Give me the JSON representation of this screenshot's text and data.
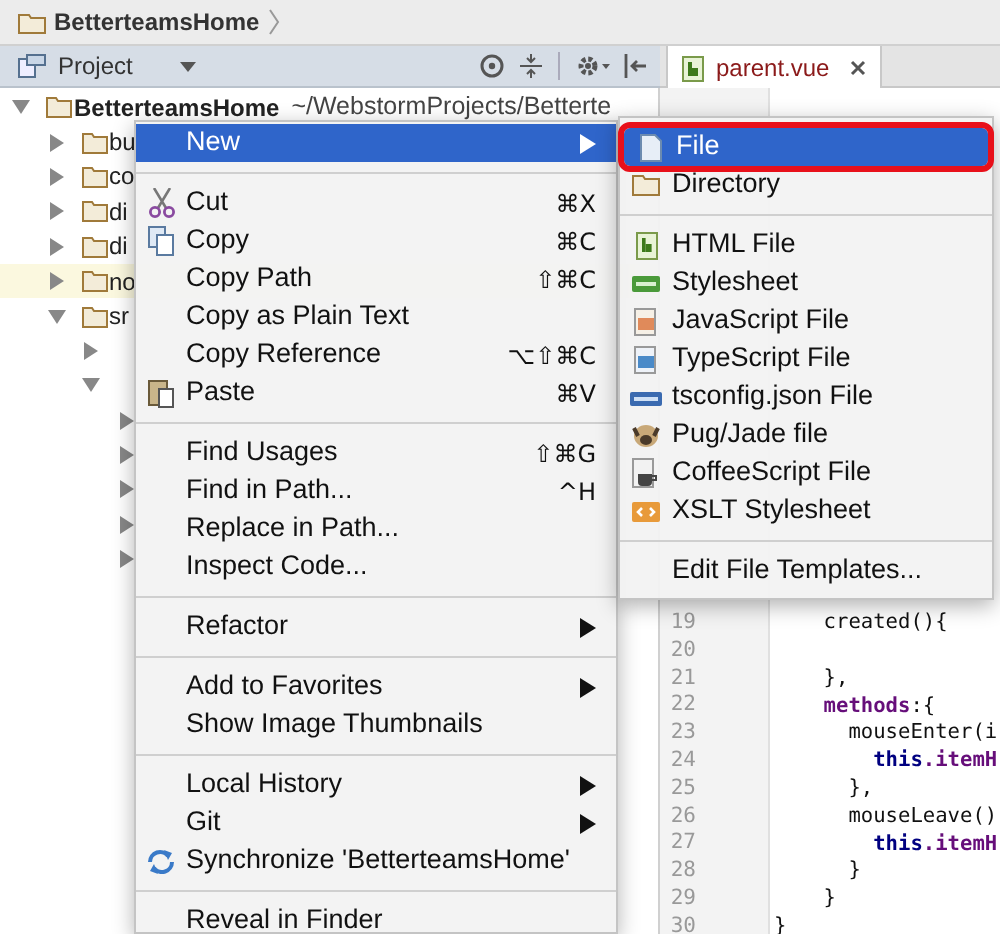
{
  "breadcrumb": {
    "label": "BetterteamsHome"
  },
  "project_panel": {
    "title": "Project"
  },
  "editor_tabs": [
    {
      "label": "parent.vue",
      "selected": true
    }
  ],
  "tree": [
    {
      "name": "BetterteamsHome",
      "path": "~/WebstormProjects/Betterte",
      "expanded": true,
      "highlighted": false,
      "children": [
        {
          "name": "bu",
          "expanded": false,
          "highlighted": false
        },
        {
          "name": "co",
          "expanded": false,
          "highlighted": false
        },
        {
          "name": "di",
          "expanded": false,
          "highlighted": false
        },
        {
          "name": "di",
          "expanded": false,
          "highlighted": false
        },
        {
          "name": "no",
          "expanded": false,
          "highlighted": true
        },
        {
          "name": "sr",
          "expanded": true,
          "highlighted": false,
          "children": [
            {
              "expanded": false,
              "highlighted": false
            },
            {
              "expanded": true,
              "highlighted": false,
              "children": [
                {
                  "expanded": false,
                  "highlighted": false
                },
                {
                  "expanded": false,
                  "highlighted": false
                },
                {
                  "expanded": false,
                  "highlighted": false
                },
                {
                  "expanded": false,
                  "highlighted": false
                },
                {
                  "expanded": false,
                  "highlighted": false
                }
              ]
            }
          ]
        }
      ]
    }
  ],
  "context_menu": [
    {
      "kind": "item",
      "label": "New",
      "submenu": true,
      "selected": true
    },
    {
      "kind": "separator"
    },
    {
      "kind": "item",
      "label": "Cut",
      "shortcut": "⌘X",
      "selected": false
    },
    {
      "kind": "item",
      "label": "Copy",
      "shortcut": "⌘C",
      "selected": false
    },
    {
      "kind": "item",
      "label": "Copy Path",
      "shortcut": "⇧⌘C",
      "selected": false
    },
    {
      "kind": "item",
      "label": "Copy as Plain Text",
      "selected": false
    },
    {
      "kind": "item",
      "label": "Copy Reference",
      "shortcut": "⌥⇧⌘C",
      "selected": false
    },
    {
      "kind": "item",
      "label": "Paste",
      "shortcut": "⌘V",
      "selected": false
    },
    {
      "kind": "separator"
    },
    {
      "kind": "item",
      "label": "Find Usages",
      "shortcut": "⇧⌘G",
      "selected": false
    },
    {
      "kind": "item",
      "label": "Find in Path...",
      "shortcut": "^H",
      "selected": false
    },
    {
      "kind": "item",
      "label": "Replace in Path...",
      "selected": false
    },
    {
      "kind": "item",
      "label": "Inspect Code...",
      "selected": false
    },
    {
      "kind": "separator"
    },
    {
      "kind": "item",
      "label": "Refactor",
      "submenu": true,
      "selected": false
    },
    {
      "kind": "separator"
    },
    {
      "kind": "item",
      "label": "Add to Favorites",
      "submenu": true,
      "selected": false
    },
    {
      "kind": "item",
      "label": "Show Image Thumbnails",
      "selected": false
    },
    {
      "kind": "separator"
    },
    {
      "kind": "item",
      "label": "Local History",
      "submenu": true,
      "selected": false
    },
    {
      "kind": "item",
      "label": "Git",
      "submenu": true,
      "selected": false
    },
    {
      "kind": "item",
      "label": "Synchronize 'BetterteamsHome'",
      "selected": false
    },
    {
      "kind": "separator"
    },
    {
      "kind": "item",
      "label": "Reveal in Finder",
      "selected": false
    }
  ],
  "new_submenu": [
    {
      "kind": "item",
      "label": "File",
      "selected": true,
      "outlined": true
    },
    {
      "kind": "item",
      "label": "Directory",
      "selected": false,
      "outlined": false
    },
    {
      "kind": "separator"
    },
    {
      "kind": "item",
      "label": "HTML File",
      "selected": false,
      "outlined": false
    },
    {
      "kind": "item",
      "label": "Stylesheet",
      "selected": false,
      "outlined": false
    },
    {
      "kind": "item",
      "label": "JavaScript File",
      "selected": false,
      "outlined": false
    },
    {
      "kind": "item",
      "label": "TypeScript File",
      "selected": false,
      "outlined": false
    },
    {
      "kind": "item",
      "label": "tsconfig.json File",
      "selected": false,
      "outlined": false
    },
    {
      "kind": "item",
      "label": "Pug/Jade file",
      "selected": false,
      "outlined": false
    },
    {
      "kind": "item",
      "label": "CoffeeScript File",
      "selected": false,
      "outlined": false
    },
    {
      "kind": "item",
      "label": "XSLT Stylesheet",
      "selected": false,
      "outlined": false
    },
    {
      "kind": "separator"
    },
    {
      "kind": "item",
      "label": "Edit File Templates...",
      "selected": false,
      "outlined": false
    }
  ],
  "code_lines": [
    {
      "number": "19",
      "tokens": [
        {
          "text": "    created(){",
          "kind": "plain"
        }
      ]
    },
    {
      "number": "20"
    },
    {
      "number": "21",
      "tokens": [
        {
          "text": "    },",
          "kind": "plain"
        }
      ]
    },
    {
      "number": "22",
      "tokens": [
        {
          "text": "    methods",
          "kind": "property"
        },
        {
          "text": ":{",
          "kind": "plain"
        }
      ]
    },
    {
      "number": "23",
      "tokens": [
        {
          "text": "      mouseEnter(i",
          "kind": "plain"
        }
      ]
    },
    {
      "number": "24",
      "tokens": [
        {
          "text": "        this",
          "kind": "keyword"
        },
        {
          "text": ".itemH",
          "kind": "property"
        }
      ]
    },
    {
      "number": "25",
      "tokens": [
        {
          "text": "      },",
          "kind": "plain"
        }
      ]
    },
    {
      "number": "26",
      "tokens": [
        {
          "text": "      mouseLeave()",
          "kind": "plain"
        }
      ]
    },
    {
      "number": "27",
      "tokens": [
        {
          "text": "        this",
          "kind": "keyword"
        },
        {
          "text": ".itemH",
          "kind": "property"
        }
      ]
    },
    {
      "number": "28",
      "tokens": [
        {
          "text": "      }",
          "kind": "plain"
        }
      ]
    },
    {
      "number": "29",
      "tokens": [
        {
          "text": "    }",
          "kind": "plain"
        }
      ]
    },
    {
      "number": "30",
      "tokens": [
        {
          "text": "}",
          "kind": "plain"
        }
      ]
    }
  ]
}
